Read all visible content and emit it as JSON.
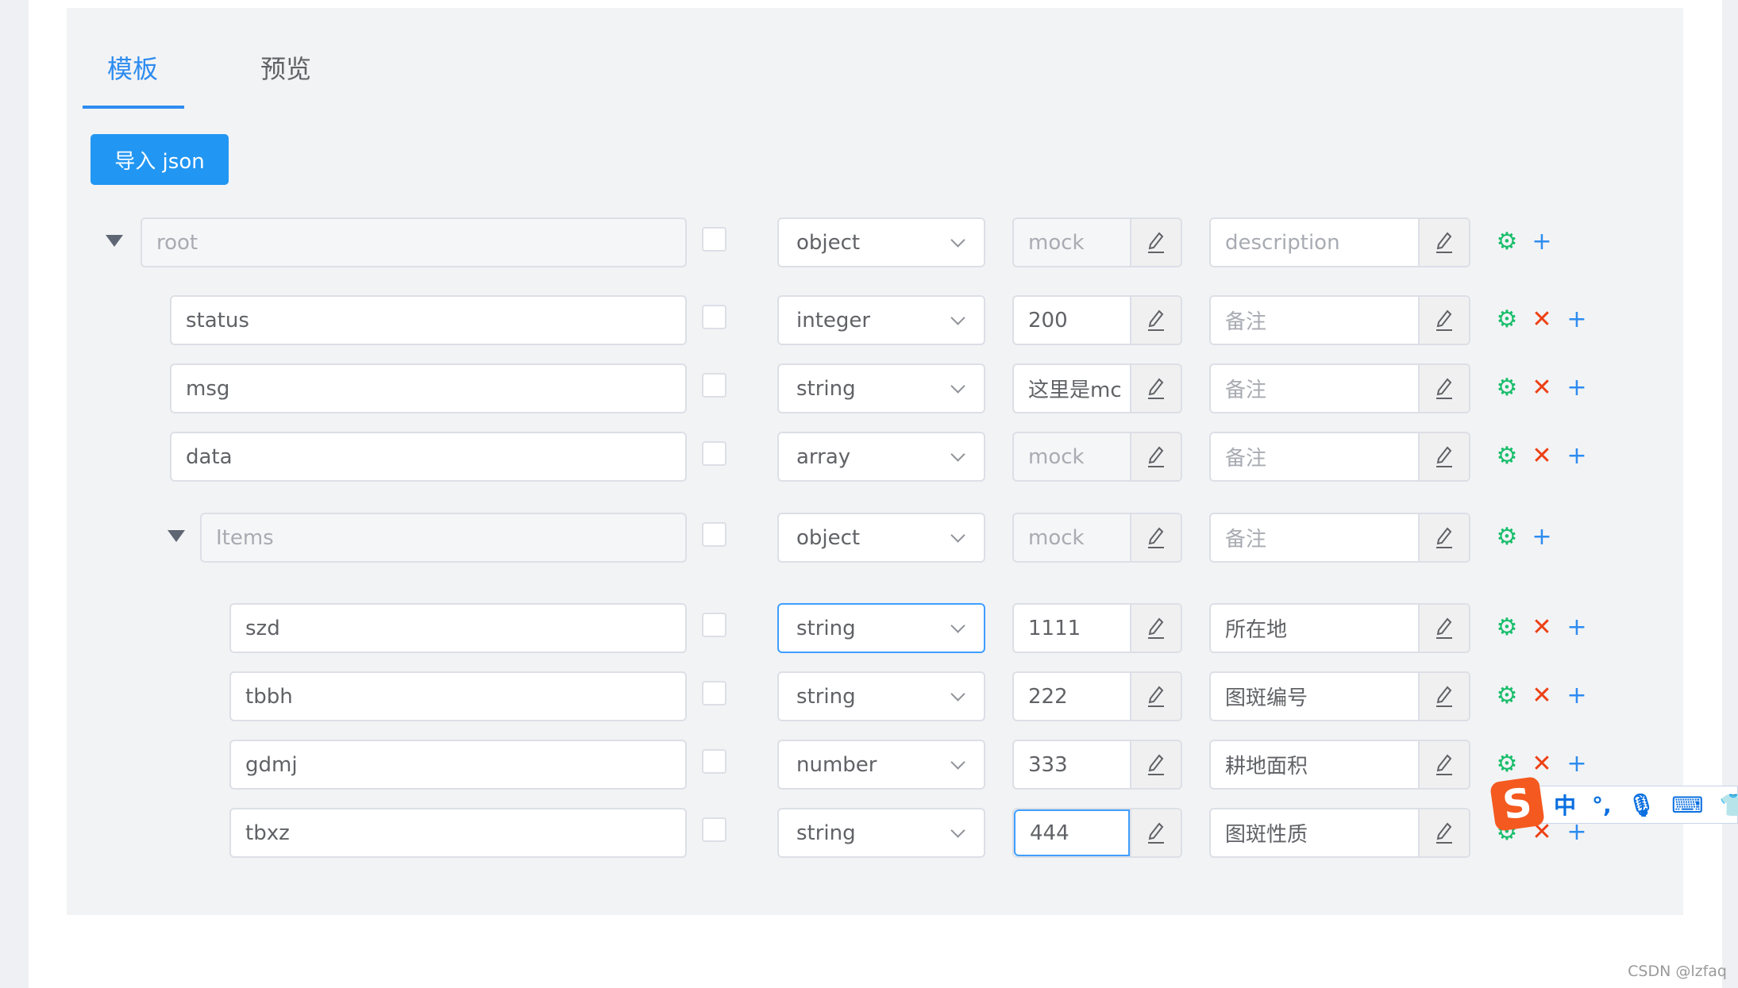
{
  "tabs": [
    {
      "label": "模板",
      "active": true
    },
    {
      "label": "预览",
      "active": false
    }
  ],
  "import_button": "导入 json",
  "rows": [
    {
      "name": "root",
      "type": "object",
      "mock": "mock",
      "mock_placeholder": true,
      "desc": "description",
      "desc_placeholder": true,
      "collapsible": true,
      "deletable": false,
      "disabled": true
    },
    {
      "name": "status",
      "type": "integer",
      "mock": "200",
      "desc": "备注",
      "desc_placeholder": true,
      "deletable": true
    },
    {
      "name": "msg",
      "type": "string",
      "mock": "这里是mc",
      "desc": "备注",
      "desc_placeholder": true,
      "deletable": true
    },
    {
      "name": "data",
      "type": "array",
      "mock": "mock",
      "mock_placeholder": true,
      "mock_disabled": true,
      "desc": "备注",
      "desc_placeholder": true,
      "deletable": true
    },
    {
      "name": "Items",
      "type": "object",
      "mock": "mock",
      "mock_placeholder": true,
      "mock_disabled": true,
      "desc": "备注",
      "desc_placeholder": true,
      "collapsible": true,
      "deletable": false,
      "disabled": true
    },
    {
      "name": "szd",
      "type": "string",
      "mock": "1111",
      "desc": "所在地",
      "deletable": true,
      "select_focused": true
    },
    {
      "name": "tbbh",
      "type": "string",
      "mock": "222",
      "desc": "图斑编号",
      "deletable": true
    },
    {
      "name": "gdmj",
      "type": "number",
      "mock": "333",
      "desc": "耕地面积",
      "deletable": true
    },
    {
      "name": "tbxz",
      "type": "string",
      "mock": "444",
      "desc": "图斑性质",
      "deletable": true,
      "mock_focused": true
    }
  ],
  "icons": {
    "settings": "gear-icon",
    "delete": "close-icon",
    "add": "plus-icon",
    "edit": "pencil-icon",
    "collapse": "caret-down-icon"
  },
  "colors": {
    "accent": "#2d8cf0",
    "settings": "#19be6b",
    "delete": "#ed4014"
  },
  "ime_toolbar": {
    "mode": "中",
    "punct": "°,"
  },
  "watermark": "CSDN @lzfaq"
}
